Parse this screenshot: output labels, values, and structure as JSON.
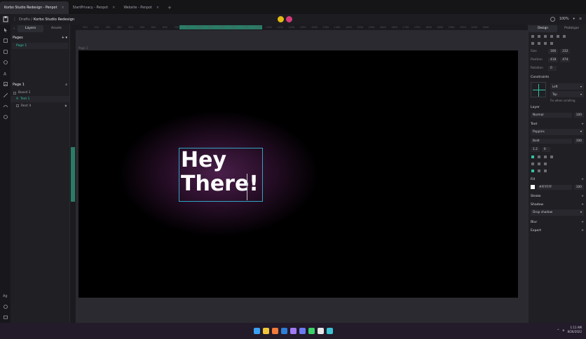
{
  "browser": {
    "tabs": [
      {
        "label": "Korbo Studio Redesign - Penpot",
        "active": true
      },
      {
        "label": "StartPrivacy - Penpot",
        "active": false
      },
      {
        "label": "Website - Penpot",
        "active": false
      }
    ],
    "close_glyph": "×",
    "new_tab_glyph": "+"
  },
  "header": {
    "project": "Drafts",
    "separator": " / ",
    "file": "Korbo Studio Redesign",
    "zoom": "100%",
    "menu_glyph": "⋮"
  },
  "layers_panel": {
    "tabs": [
      "Layers",
      "Assets"
    ],
    "pages_title": "Pages",
    "pages": [
      "Page 1"
    ],
    "page_title": "Page 1",
    "layers": [
      {
        "name": "Board 1",
        "selected": false,
        "indent": 0
      },
      {
        "name": "Text 1",
        "selected": true,
        "indent": 1
      },
      {
        "name": "Rect 4",
        "selected": false,
        "indent": 1
      }
    ]
  },
  "canvas": {
    "board_label": "Page 1",
    "text": "Hey\nThere!",
    "board_bg": "#000000",
    "glow_color": "#4a1f4a",
    "selection_color": "#31a6c3"
  },
  "ruler": {
    "top_ticks": [
      "300",
      "350",
      "400",
      "450",
      "500",
      "550",
      "600",
      "650",
      "700",
      "750",
      "800",
      "850",
      "900",
      "950",
      "1000",
      "1050",
      "1100",
      "1150",
      "1200",
      "1250",
      "1300",
      "1350",
      "1400",
      "1450",
      "1500",
      "1550",
      "1600",
      "1650",
      "1700",
      "1750",
      "1800",
      "1850",
      "1900",
      "1950",
      "2000",
      "2050"
    ],
    "highlight_start": "993",
    "highlight_end": "1232"
  },
  "design_panel": {
    "tabs": [
      "Design",
      "Prototype"
    ],
    "size_label": "Size",
    "width": "166",
    "height": "232",
    "position_label": "Position",
    "x": "418",
    "y": "474",
    "rotation_label": "Rotation",
    "rotation": "0",
    "constraints_title": "Constraints",
    "constraint_h": "Left",
    "constraint_v": "Top",
    "fix_scroll": "Fix when scrolling",
    "layer_title": "Layer",
    "blend": "Normal",
    "opacity": "100",
    "text_title": "Text",
    "font_family": "Poppins",
    "font_weight": "Bold",
    "font_size": "100",
    "line_height": "1.2",
    "letter_spacing": "0",
    "fill_title": "Fill",
    "fill_hex": "#FFFFFF",
    "fill_opacity": "100",
    "stroke_title": "Stroke",
    "shadow_title": "Shadow",
    "shadow_type": "Drop shadow",
    "blur_title": "Blur",
    "export_title": "Export",
    "accent": "#31c3a3"
  },
  "taskbar": {
    "time": "1:11 AM",
    "date": "8/26/2022",
    "icons": [
      "windows-icon",
      "files-icon",
      "firefox-icon",
      "vscode-icon",
      "github-icon",
      "discord-icon",
      "spotify-icon",
      "penpot-icon",
      "edge-icon"
    ]
  }
}
